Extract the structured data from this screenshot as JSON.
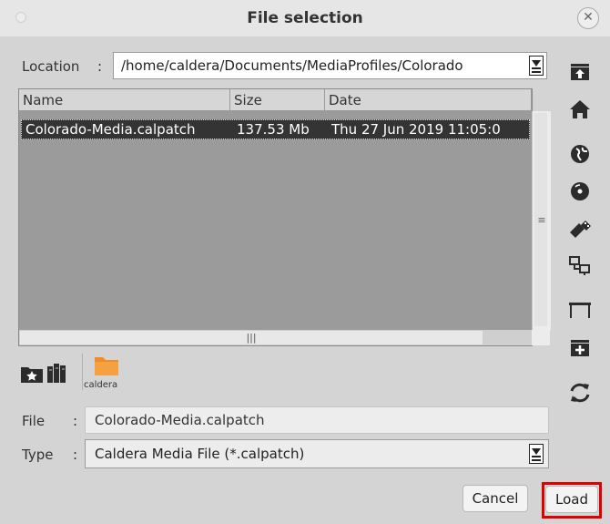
{
  "window": {
    "title": "File selection"
  },
  "location": {
    "label": "Location",
    "separator": ":",
    "value": "/home/caldera/Documents/MediaProfiles/Colorado"
  },
  "file_list": {
    "columns": [
      "Name",
      "Size",
      "Date"
    ],
    "rows": [
      {
        "name": "Colorado-Media.calpatch",
        "size": "137.53 Mb",
        "date": "Thu 27 Jun 2019 11:05:0"
      }
    ]
  },
  "bookmarks": {
    "folder_label": "caldera",
    "folder_color": "#f08c28"
  },
  "file": {
    "label": "File",
    "separator": ":",
    "value": "Colorado-Media.calpatch"
  },
  "type": {
    "label": "Type",
    "separator": ":",
    "value": "Caldera Media File (*.calpatch)"
  },
  "buttons": {
    "cancel": "Cancel",
    "load": "Load"
  },
  "side_icons": [
    "parent-folder-icon",
    "home-icon",
    "network-globe-icon",
    "disc-icon",
    "usb-drive-icon",
    "network-share-icon",
    "table-icon",
    "new-folder-icon",
    "refresh-icon"
  ],
  "colors": {
    "highlight": "#e00000",
    "selection": "#343434"
  }
}
